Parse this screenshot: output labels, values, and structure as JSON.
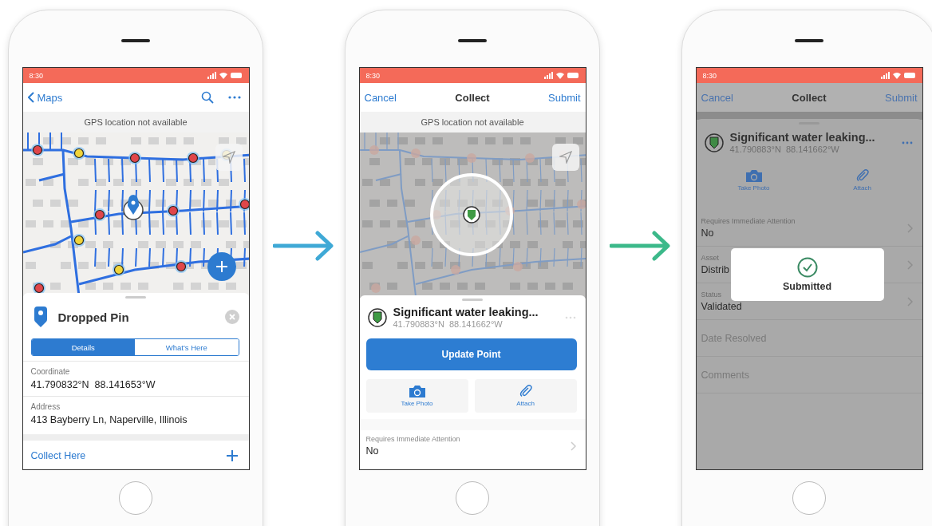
{
  "arrows": [
    {
      "color": "#3fa9d6"
    },
    {
      "color": "#3cb98a"
    }
  ],
  "map_screen": {
    "status_bar": {
      "time": "8:30"
    },
    "back": "Maps",
    "banner": "GPS location not available",
    "sheet": {
      "title": "Dropped Pin",
      "tabs": [
        {
          "label": "Details",
          "selected": true
        },
        {
          "label": "What's Here",
          "selected": false
        }
      ],
      "fields": [
        {
          "label": "Coordinate",
          "value": "41.790832°N  88.141653°W"
        },
        {
          "label": "Address",
          "value": "413 Bayberry Ln, Naperville, Illinois"
        }
      ],
      "action": "Collect Here"
    }
  },
  "collect_screen": {
    "status_bar": {
      "time": "8:30"
    },
    "cancel": "Cancel",
    "title": "Collect",
    "submit": "Submit",
    "banner": "GPS location not available",
    "feature": {
      "title": "Significant water leaking...",
      "coordinates": "41.790883°N  88.141662°W"
    },
    "primary_button": "Update Point",
    "attachments": [
      {
        "kind": "camera",
        "label": "Take Photo"
      },
      {
        "kind": "paperclip",
        "label": "Attach"
      }
    ],
    "fields": [
      {
        "label": "Requires Immediate Attention",
        "value": "No"
      }
    ]
  },
  "submitted_screen": {
    "status_bar": {
      "time": "8:30"
    },
    "dimmed": true,
    "cancel": "Cancel",
    "title": "Collect",
    "submit": "Submit",
    "feature": {
      "title": "Significant water leaking...",
      "coordinates": "41.790883°N  88.141662°W"
    },
    "attachments": [
      {
        "kind": "camera",
        "label": "Take Photo"
      },
      {
        "kind": "paperclip",
        "label": "Attach"
      }
    ],
    "fields": [
      {
        "label": "Requires Immediate Attention",
        "value": "No"
      },
      {
        "label": "Asset",
        "value": "Distrib"
      },
      {
        "label": "Status",
        "value": "Validated"
      },
      {
        "label": "Date Resolved"
      },
      {
        "label": "Comments"
      }
    ],
    "toast": "Submitted"
  }
}
